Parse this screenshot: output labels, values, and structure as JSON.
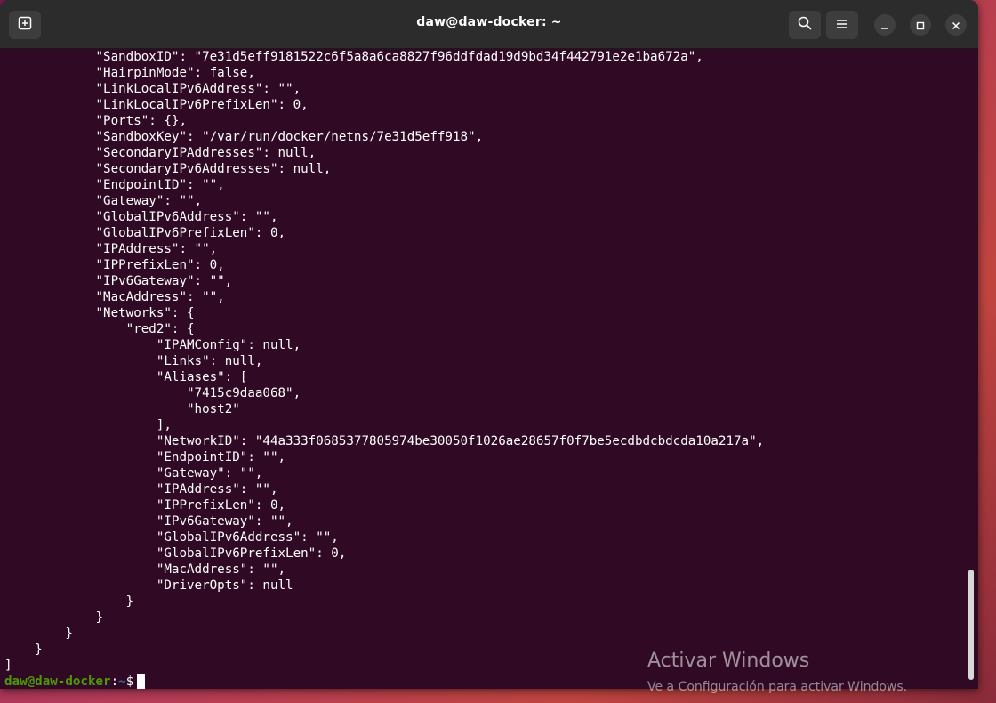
{
  "window": {
    "title": "daw@daw-docker: ~"
  },
  "icons": {
    "new_tab": "new-tab-icon",
    "search": "search-icon",
    "menu": "hamburger-menu-icon",
    "minimize": "minimize-icon",
    "maximize": "maximize-icon",
    "close": "close-icon"
  },
  "terminal": {
    "lines": [
      "            \"SandboxID\": \"7e31d5eff9181522c6f5a8a6ca8827f96ddfdad19d9bd34f442791e2e1ba672a\",",
      "            \"HairpinMode\": false,",
      "            \"LinkLocalIPv6Address\": \"\",",
      "            \"LinkLocalIPv6PrefixLen\": 0,",
      "            \"Ports\": {},",
      "            \"SandboxKey\": \"/var/run/docker/netns/7e31d5eff918\",",
      "            \"SecondaryIPAddresses\": null,",
      "            \"SecondaryIPv6Addresses\": null,",
      "            \"EndpointID\": \"\",",
      "            \"Gateway\": \"\",",
      "            \"GlobalIPv6Address\": \"\",",
      "            \"GlobalIPv6PrefixLen\": 0,",
      "            \"IPAddress\": \"\",",
      "            \"IPPrefixLen\": 0,",
      "            \"IPv6Gateway\": \"\",",
      "            \"MacAddress\": \"\",",
      "            \"Networks\": {",
      "                \"red2\": {",
      "                    \"IPAMConfig\": null,",
      "                    \"Links\": null,",
      "                    \"Aliases\": [",
      "                        \"7415c9daa068\",",
      "                        \"host2\"",
      "                    ],",
      "                    \"NetworkID\": \"44a333f0685377805974be30050f1026ae28657f0f7be5ecdbdcbdcda10a217a\",",
      "                    \"EndpointID\": \"\",",
      "                    \"Gateway\": \"\",",
      "                    \"IPAddress\": \"\",",
      "                    \"IPPrefixLen\": 0,",
      "                    \"IPv6Gateway\": \"\",",
      "                    \"GlobalIPv6Address\": \"\",",
      "                    \"GlobalIPv6PrefixLen\": 0,",
      "                    \"MacAddress\": \"\",",
      "                    \"DriverOpts\": null",
      "                }",
      "            }",
      "        }",
      "    }",
      "]"
    ],
    "prompt": {
      "user_host": "daw@daw-docker",
      "separator": ":",
      "path": "~",
      "symbol": "$"
    }
  },
  "watermark": {
    "title": "Activar Windows",
    "subtitle": "Ve a Configuración para activar Windows."
  }
}
